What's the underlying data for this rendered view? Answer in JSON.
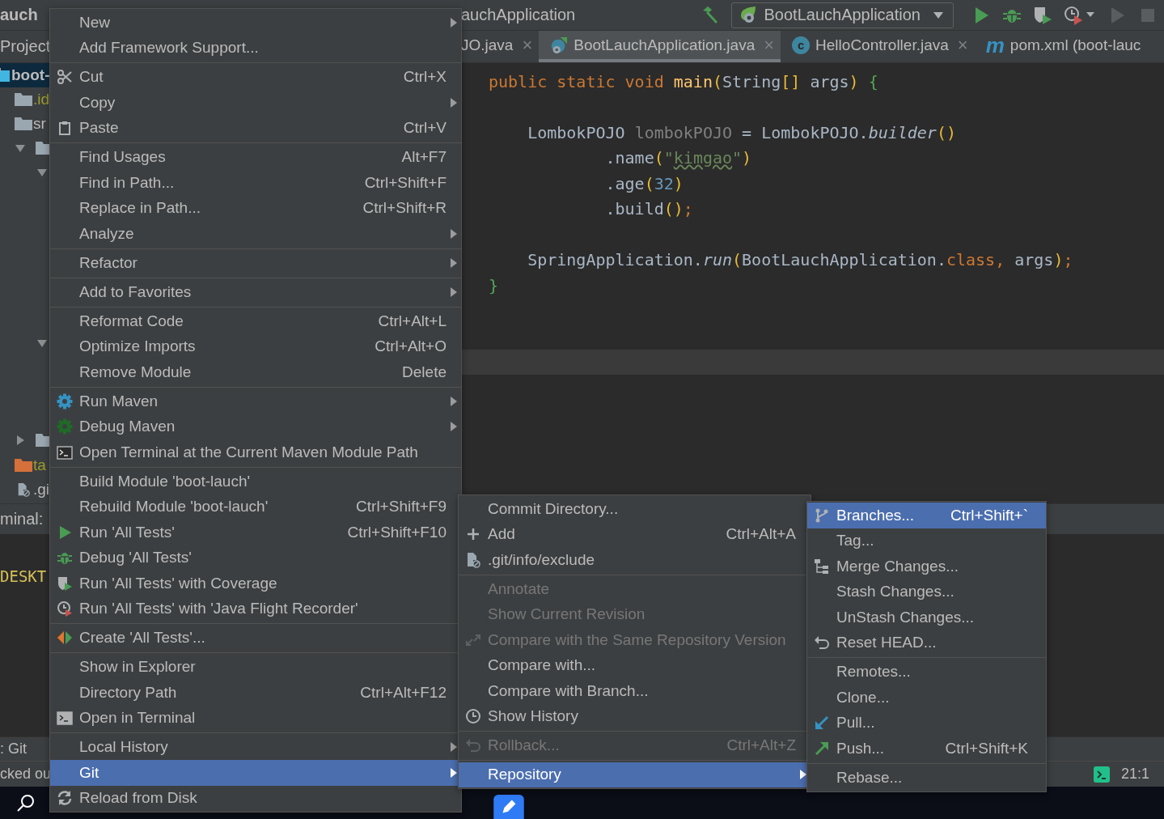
{
  "navbar": {
    "breadcrumb_start": "auch",
    "breadcrumb_file": "auchApplication",
    "run_config": "BootLauchApplication"
  },
  "tool_window_title": "Project",
  "tabs": [
    {
      "label": "JO.java",
      "close": "×",
      "selected": false
    },
    {
      "label": "BootLauchApplication.java",
      "kind": "spring",
      "close": "×",
      "selected": true
    },
    {
      "label": "HelloController.java",
      "kind": "class",
      "badge": "c",
      "close": "×",
      "selected": false
    },
    {
      "label": "pom.xml (boot-lauc",
      "kind": "maven",
      "badge": "m",
      "selected": false
    }
  ],
  "project_tree": [
    {
      "label": "boot-",
      "kind": "module",
      "selected": true,
      "children": [
        {
          "label": ".id",
          "kind": "excluded-folder",
          "selected": false
        },
        {
          "label": "sr",
          "kind": "folder",
          "selected": false
        },
        {
          "kind": "folder",
          "expanded": true,
          "selected": false,
          "children": [
            {
              "expanded": true,
              "selected": false,
              "children": [
                {
                  "selected": false
                },
                {
                  "selected": false
                },
                {
                  "selected": false
                },
                {
                  "selected": false
                },
                {
                  "selected": false
                },
                {
                  "selected": false
                }
              ]
            },
            {
              "expanded": true,
              "selected": false,
              "children": [
                {
                  "selected": false
                },
                {
                  "selected": false
                },
                {
                  "selected": false
                }
              ]
            }
          ]
        },
        {
          "kind": "folder",
          "expanded": false,
          "selected": false
        },
        {
          "label": "ta",
          "kind": "target-folder",
          "selected": false
        },
        {
          "label": ".gi",
          "kind": "ignored-file",
          "selected": false
        }
      ]
    }
  ],
  "editor": {
    "lines": [
      {
        "kind": "code",
        "tokens": [
          {
            "text": "public static void ",
            "kind": "keyword"
          },
          {
            "text": "main",
            "kind": "method"
          },
          {
            "text": "(",
            "kind": "bracket"
          },
          {
            "text": "String",
            "kind": "plain"
          },
          {
            "text": "[]",
            "kind": "bracket"
          },
          {
            "text": " args",
            "kind": "plain"
          },
          {
            "text": ")",
            "kind": "bracket"
          },
          {
            "text": " {",
            "kind": "brace"
          }
        ]
      },
      {
        "kind": "blank"
      },
      {
        "kind": "code",
        "tokens": [
          {
            "text": "    LombokPOJO ",
            "kind": "plain"
          },
          {
            "text": "lombokPOJO",
            "kind": "unused"
          },
          {
            "text": " = LombokPOJO.",
            "kind": "plain"
          },
          {
            "text": "builder",
            "kind": "static"
          },
          {
            "text": "()",
            "kind": "bracket"
          }
        ]
      },
      {
        "kind": "code",
        "tokens": [
          {
            "text": "            .name",
            "kind": "plain"
          },
          {
            "text": "(",
            "kind": "bracket"
          },
          {
            "text": "\"",
            "kind": "string"
          },
          {
            "text": "kimgao",
            "kind": "typo"
          },
          {
            "text": "\"",
            "kind": "string"
          },
          {
            "text": ")",
            "kind": "bracket"
          }
        ]
      },
      {
        "kind": "code",
        "tokens": [
          {
            "text": "            .age",
            "kind": "plain"
          },
          {
            "text": "(",
            "kind": "bracket"
          },
          {
            "text": "32",
            "kind": "number"
          },
          {
            "text": ")",
            "kind": "bracket"
          }
        ]
      },
      {
        "kind": "code",
        "tokens": [
          {
            "text": "            .build",
            "kind": "plain"
          },
          {
            "text": "()",
            "kind": "bracket"
          },
          {
            "text": ";",
            "kind": "keyword"
          }
        ]
      },
      {
        "kind": "blank"
      },
      {
        "kind": "code",
        "tokens": [
          {
            "text": "    SpringApplication.",
            "kind": "plain"
          },
          {
            "text": "run",
            "kind": "static"
          },
          {
            "text": "(",
            "kind": "bracket"
          },
          {
            "text": "BootLauchApplication.",
            "kind": "plain"
          },
          {
            "text": "class, ",
            "kind": "keyword"
          },
          {
            "text": "args",
            "kind": "plain"
          },
          {
            "text": ")",
            "kind": "bracket"
          },
          {
            "text": ";",
            "kind": "keyword"
          }
        ]
      },
      {
        "kind": "code",
        "tokens": [
          {
            "text": "}",
            "kind": "brace"
          }
        ]
      },
      {
        "kind": "blank"
      },
      {
        "kind": "blank"
      },
      {
        "kind": "caret"
      }
    ]
  },
  "terminal": {
    "title": "minal:",
    "prompt": "DESKT"
  },
  "tool_strip": ": Git",
  "status_bar": {
    "message": "cked ou",
    "position": "21:1"
  },
  "menus": [
    {
      "groups": [
        [
          {
            "label": "New",
            "kind": "text",
            "submenu": true,
            "disabled": false,
            "selected": false
          },
          {
            "label": "Add Framework Support...",
            "kind": "text",
            "submenu": false,
            "disabled": false,
            "selected": false
          }
        ],
        [
          {
            "label": "Cut",
            "shortcut": "Ctrl+X",
            "kind": "scissors",
            "submenu": false,
            "disabled": false,
            "selected": false
          },
          {
            "label": "Copy",
            "kind": "text",
            "submenu": true,
            "disabled": false,
            "selected": false
          },
          {
            "label": "Paste",
            "shortcut": "Ctrl+V",
            "kind": "clipboard",
            "submenu": false,
            "disabled": false,
            "selected": false
          }
        ],
        [
          {
            "label": "Find Usages",
            "shortcut": "Alt+F7",
            "kind": "text",
            "submenu": false,
            "disabled": false,
            "selected": false
          },
          {
            "label": "Find in Path...",
            "shortcut": "Ctrl+Shift+F",
            "kind": "text",
            "submenu": false,
            "disabled": false,
            "selected": false
          },
          {
            "label": "Replace in Path...",
            "shortcut": "Ctrl+Shift+R",
            "kind": "text",
            "submenu": false,
            "disabled": false,
            "selected": false
          },
          {
            "label": "Analyze",
            "kind": "text",
            "submenu": true,
            "disabled": false,
            "selected": false
          }
        ],
        [
          {
            "label": "Refactor",
            "kind": "text",
            "submenu": true,
            "disabled": false,
            "selected": false
          }
        ],
        [
          {
            "label": "Add to Favorites",
            "kind": "text",
            "submenu": true,
            "disabled": false,
            "selected": false
          }
        ],
        [
          {
            "label": "Reformat Code",
            "shortcut": "Ctrl+Alt+L",
            "kind": "text",
            "submenu": false,
            "disabled": false,
            "selected": false
          },
          {
            "label": "Optimize Imports",
            "shortcut": "Ctrl+Alt+O",
            "kind": "text",
            "submenu": false,
            "disabled": false,
            "selected": false
          },
          {
            "label": "Remove Module",
            "shortcut": "Delete",
            "kind": "text",
            "submenu": false,
            "disabled": false,
            "selected": false
          }
        ],
        [
          {
            "label": "Run Maven",
            "kind": "gear",
            "submenu": true,
            "disabled": false,
            "selected": false
          },
          {
            "label": "Debug Maven",
            "kind": "gear-dark",
            "submenu": true,
            "disabled": false,
            "selected": false
          },
          {
            "label": "Open Terminal at the Current Maven Module Path",
            "kind": "terminal",
            "submenu": false,
            "disabled": false,
            "selected": false
          }
        ],
        [
          {
            "label": "Build Module 'boot-lauch'",
            "kind": "text",
            "submenu": false,
            "disabled": false,
            "selected": false
          },
          {
            "label": "Rebuild Module 'boot-lauch'",
            "shortcut": "Ctrl+Shift+F9",
            "kind": "text",
            "submenu": false,
            "disabled": false,
            "selected": false
          },
          {
            "label": "Run 'All Tests'",
            "shortcut": "Ctrl+Shift+F10",
            "kind": "play",
            "submenu": false,
            "disabled": false,
            "selected": false
          },
          {
            "label": "Debug 'All Tests'",
            "kind": "bug",
            "submenu": false,
            "disabled": false,
            "selected": false
          },
          {
            "label": "Run 'All Tests' with Coverage",
            "kind": "shield",
            "submenu": false,
            "disabled": false,
            "selected": false
          },
          {
            "label": "Run 'All Tests' with 'Java Flight Recorder'",
            "kind": "clock-play",
            "submenu": false,
            "disabled": false,
            "selected": false
          }
        ],
        [
          {
            "label": "Create 'All Tests'...",
            "kind": "diamond",
            "submenu": false,
            "disabled": false,
            "selected": false
          }
        ],
        [
          {
            "label": "Show in Explorer",
            "kind": "text",
            "submenu": false,
            "disabled": false,
            "selected": false
          },
          {
            "label": "Directory Path",
            "shortcut": "Ctrl+Alt+F12",
            "kind": "text",
            "submenu": false,
            "disabled": false,
            "selected": false
          },
          {
            "label": "Open in Terminal",
            "kind": "terminal-solid",
            "submenu": false,
            "disabled": false,
            "selected": false
          }
        ],
        [
          {
            "label": "Local History",
            "kind": "text",
            "submenu": true,
            "disabled": false,
            "selected": false
          },
          {
            "label": "Git",
            "kind": "text",
            "submenu": true,
            "disabled": false,
            "selected": true
          },
          {
            "label": "Reload from Disk",
            "kind": "refresh",
            "submenu": false,
            "disabled": false,
            "selected": false
          }
        ]
      ]
    },
    {
      "groups": [
        [
          {
            "label": "Commit Directory...",
            "kind": "text",
            "submenu": false,
            "disabled": false,
            "selected": false
          },
          {
            "label": "Add",
            "shortcut": "Ctrl+Alt+A",
            "kind": "plus",
            "submenu": false,
            "disabled": false,
            "selected": false
          },
          {
            "label": ".git/info/exclude",
            "kind": "file-blocked",
            "submenu": false,
            "disabled": false,
            "selected": false
          }
        ],
        [
          {
            "label": "Annotate",
            "kind": "text",
            "submenu": false,
            "disabled": true,
            "selected": false
          },
          {
            "label": "Show Current Revision",
            "kind": "text",
            "submenu": false,
            "disabled": true,
            "selected": false
          },
          {
            "label": "Compare with the Same Repository Version",
            "kind": "arrows",
            "submenu": false,
            "disabled": true,
            "selected": false
          },
          {
            "label": "Compare with...",
            "kind": "text",
            "submenu": false,
            "disabled": false,
            "selected": false
          },
          {
            "label": "Compare with Branch...",
            "kind": "text",
            "submenu": false,
            "disabled": false,
            "selected": false
          },
          {
            "label": "Show History",
            "kind": "clock",
            "submenu": false,
            "disabled": false,
            "selected": false
          }
        ],
        [
          {
            "label": "Rollback...",
            "shortcut": "Ctrl+Alt+Z",
            "kind": "undo",
            "submenu": false,
            "disabled": true,
            "selected": false
          }
        ],
        [
          {
            "label": "Repository",
            "kind": "text",
            "submenu": true,
            "disabled": false,
            "selected": true
          }
        ]
      ]
    },
    {
      "groups": [
        [
          {
            "label": "Branches...",
            "shortcut": "Ctrl+Shift+`",
            "kind": "branch",
            "submenu": false,
            "disabled": false,
            "selected": true
          },
          {
            "label": "Tag...",
            "kind": "text",
            "submenu": false,
            "disabled": false,
            "selected": false
          },
          {
            "label": "Merge Changes...",
            "kind": "merge",
            "submenu": false,
            "disabled": false,
            "selected": false
          },
          {
            "label": "Stash Changes...",
            "kind": "text",
            "submenu": false,
            "disabled": false,
            "selected": false
          },
          {
            "label": "UnStash Changes...",
            "kind": "text",
            "submenu": false,
            "disabled": false,
            "selected": false
          },
          {
            "label": "Reset HEAD...",
            "kind": "undo",
            "submenu": false,
            "disabled": false,
            "selected": false
          }
        ],
        [
          {
            "label": "Remotes...",
            "kind": "text",
            "submenu": false,
            "disabled": false,
            "selected": false
          },
          {
            "label": "Clone...",
            "kind": "text",
            "submenu": false,
            "disabled": false,
            "selected": false
          },
          {
            "label": "Pull...",
            "kind": "pull",
            "submenu": false,
            "disabled": false,
            "selected": false
          },
          {
            "label": "Push...",
            "shortcut": "Ctrl+Shift+K",
            "kind": "push",
            "submenu": false,
            "disabled": false,
            "selected": false
          }
        ],
        [
          {
            "label": "Rebase...",
            "kind": "text",
            "submenu": false,
            "disabled": false,
            "selected": false
          }
        ]
      ]
    }
  ]
}
